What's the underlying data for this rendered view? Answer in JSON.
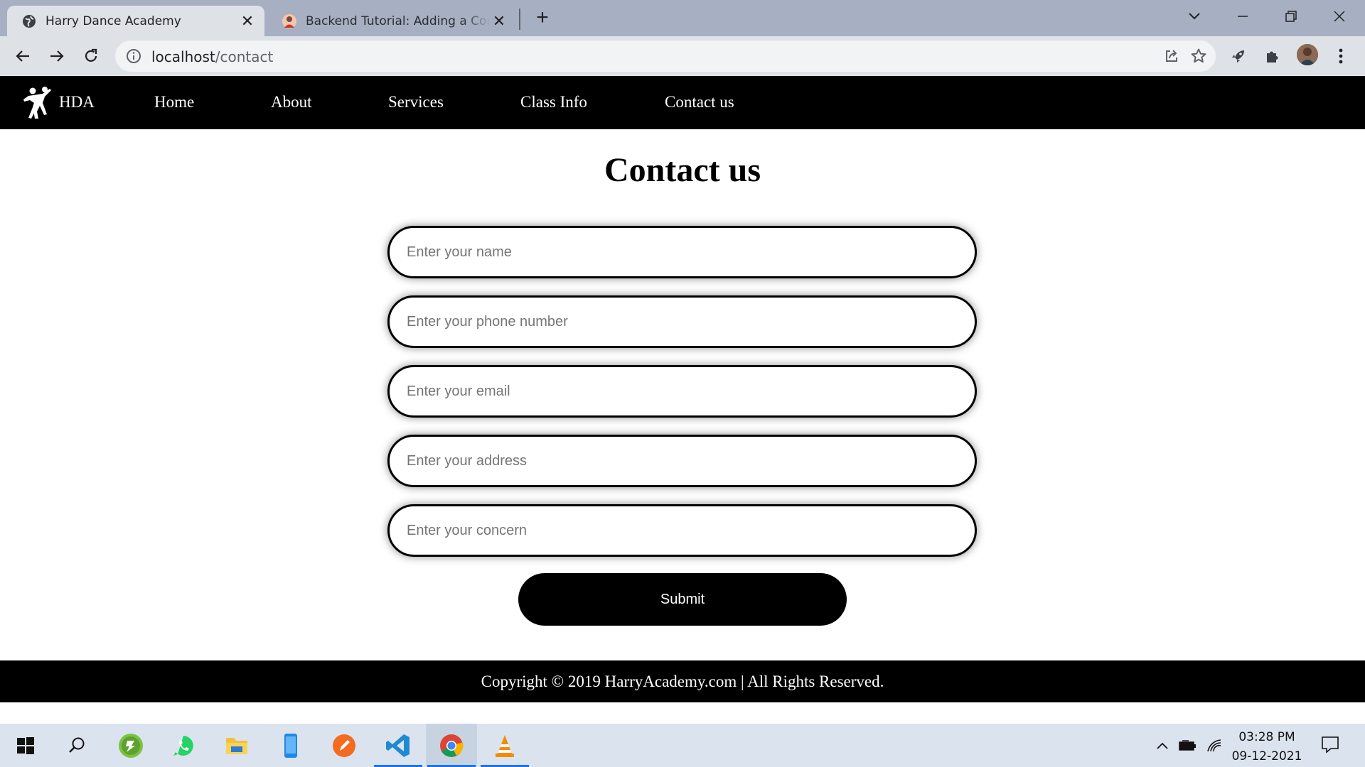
{
  "browser": {
    "tabs": [
      {
        "title": "Harry Dance Academy",
        "active": true,
        "icon": "globe-icon"
      },
      {
        "title": "Backend Tutorial: Adding a Conta",
        "active": false,
        "icon": "avatar-favicon"
      }
    ],
    "url_host": "localhost",
    "url_path": "/contact"
  },
  "site": {
    "brand": "HDA",
    "nav": [
      "Home",
      "About",
      "Services",
      "Class Info",
      "Contact us"
    ],
    "page_title": "Contact us",
    "form": {
      "name_placeholder": "Enter your name",
      "phone_placeholder": "Enter your phone number",
      "email_placeholder": "Enter your email",
      "address_placeholder": "Enter your address",
      "concern_placeholder": "Enter your concern",
      "submit_label": "Submit"
    },
    "footer": "Copyright © 2019 HarryAcademy.com | All Rights Reserved."
  },
  "taskbar": {
    "time": "03:28 PM",
    "date": "09-12-2021",
    "apps": [
      "start-icon",
      "search-icon",
      "app-icon",
      "whatsapp-icon",
      "file-explorer-icon",
      "phone-icon",
      "pen-app-icon",
      "vscode-icon",
      "chrome-icon",
      "vlc-icon"
    ]
  },
  "colors": {
    "nav_bg": "#000000",
    "tabstrip": "#a7b0c2",
    "toolbar": "#dee1e6",
    "taskbar": "#dbe3ee"
  }
}
